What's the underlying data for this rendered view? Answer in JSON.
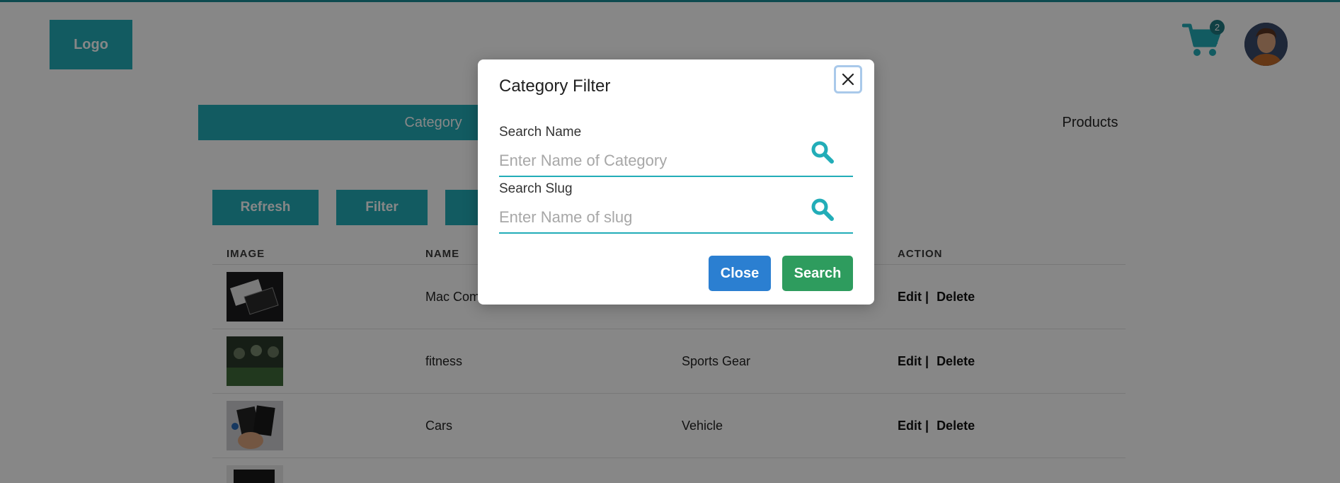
{
  "header": {
    "logo": "Logo",
    "cart_count": "2"
  },
  "tabs": [
    {
      "label": "Category"
    },
    {
      "label": "Products"
    }
  ],
  "toolbar": {
    "refresh": "Refresh",
    "filter": "Filter"
  },
  "table": {
    "columns": [
      "IMAGE",
      "NAME",
      "ACTION"
    ],
    "rows": [
      {
        "name": "Mac Com",
        "category": ""
      },
      {
        "name": "fitness",
        "category": "Sports Gear"
      },
      {
        "name": "Cars",
        "category": "Vehicle"
      }
    ],
    "action_edit": "Edit |",
    "action_delete": "Delete"
  },
  "modal": {
    "title": "Category Filter",
    "name_label": "Search Name",
    "name_placeholder": "Enter Name of Category",
    "slug_label": "Search Slug",
    "slug_placeholder": "Enter Name of slug",
    "close_button": "Close",
    "search_button": "Search"
  },
  "colors": {
    "accent": "#22adb8",
    "close": "#2b7fd1",
    "search": "#2e9c5e"
  }
}
